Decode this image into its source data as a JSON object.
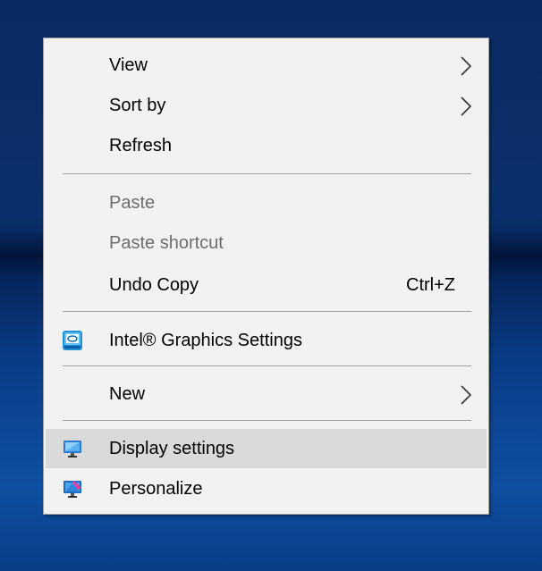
{
  "menu": {
    "items": [
      {
        "label": "View",
        "has_submenu": true
      },
      {
        "label": "Sort by",
        "has_submenu": true
      },
      {
        "label": "Refresh"
      },
      {
        "label": "Paste",
        "disabled": true
      },
      {
        "label": "Paste shortcut",
        "disabled": true
      },
      {
        "label": "Undo Copy",
        "shortcut": "Ctrl+Z"
      },
      {
        "label": "Intel® Graphics Settings",
        "icon": "intel-graphics-icon"
      },
      {
        "label": "New",
        "has_submenu": true
      },
      {
        "label": "Display settings",
        "icon": "display-settings-icon",
        "highlighted": true
      },
      {
        "label": "Personalize",
        "icon": "personalize-icon"
      }
    ]
  },
  "colors": {
    "menu_bg": "#f2f2f2",
    "hover_bg": "#dadada",
    "disabled_text": "#6d6d6d",
    "separator": "#a0a0a0"
  }
}
